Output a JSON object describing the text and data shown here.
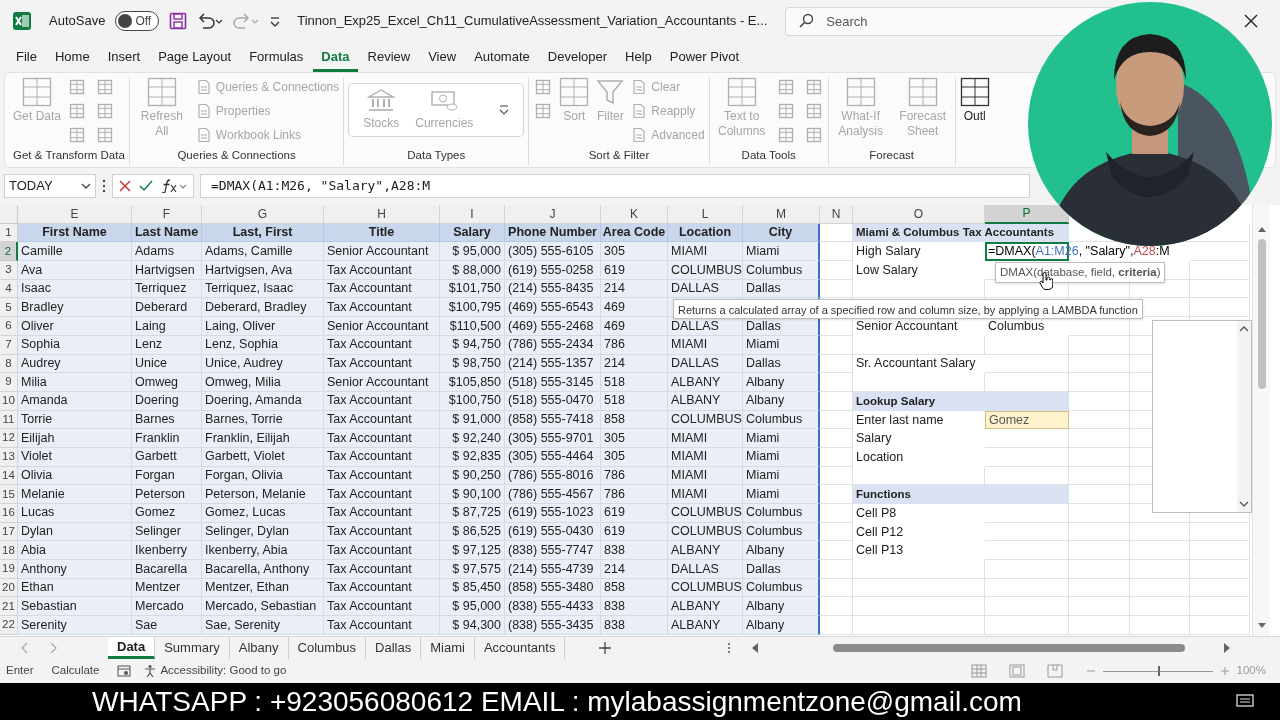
{
  "title_bar": {
    "autosave_label": "AutoSave",
    "autosave": {
      "on": false,
      "label": "Off"
    },
    "filename": "Tinnon_Exp25_Excel_Ch11_CumulativeAssessment_Variation_Accountants - E...",
    "search_placeholder": "Search"
  },
  "menu_tabs": [
    {
      "label": "File",
      "selected": false
    },
    {
      "label": "Home",
      "selected": false
    },
    {
      "label": "Insert",
      "selected": false
    },
    {
      "label": "Page Layout",
      "selected": false
    },
    {
      "label": "Formulas",
      "selected": false
    },
    {
      "label": "Data",
      "selected": true
    },
    {
      "label": "Review",
      "selected": false
    },
    {
      "label": "View",
      "selected": false
    },
    {
      "label": "Automate",
      "selected": false
    },
    {
      "label": "Developer",
      "selected": false
    },
    {
      "label": "Help",
      "selected": false
    },
    {
      "label": "Power Pivot",
      "selected": false
    }
  ],
  "ribbon_groups": [
    {
      "label": "Get & Transform Data",
      "items": [
        {
          "kind": "large",
          "label": "Get Data",
          "disabled": true
        },
        {
          "kind": "icon",
          "disabled": true
        },
        {
          "kind": "icon",
          "disabled": true
        },
        {
          "kind": "icon",
          "disabled": true
        },
        {
          "kind": "icon",
          "disabled": true
        },
        {
          "kind": "icon",
          "disabled": true
        },
        {
          "kind": "icon",
          "disabled": true
        }
      ]
    },
    {
      "label": "Queries & Connections",
      "items": [
        {
          "kind": "large",
          "label": "Refresh All",
          "disabled": true
        },
        {
          "kind": "small",
          "label": "Queries & Connections",
          "disabled": true
        },
        {
          "kind": "small",
          "label": "Properties",
          "disabled": true
        },
        {
          "kind": "small",
          "label": "Workbook Links",
          "disabled": true
        }
      ]
    },
    {
      "label": "Data Types",
      "items": [
        {
          "kind": "gallery",
          "label": "Stocks",
          "disabled": true
        },
        {
          "kind": "gallery",
          "label": "Currencies",
          "disabled": true
        }
      ]
    },
    {
      "label": "Sort & Filter",
      "items": [
        {
          "kind": "icon",
          "disabled": true
        },
        {
          "kind": "icon",
          "disabled": true
        },
        {
          "kind": "large",
          "label": "Sort",
          "disabled": true
        },
        {
          "kind": "large",
          "label": "Filter",
          "disabled": true
        },
        {
          "kind": "small",
          "label": "Clear",
          "disabled": true
        },
        {
          "kind": "small",
          "label": "Reapply",
          "disabled": true
        },
        {
          "kind": "small",
          "label": "Advanced",
          "disabled": true
        }
      ]
    },
    {
      "label": "Data Tools",
      "items": [
        {
          "kind": "large",
          "label": "Text to Columns",
          "disabled": true
        },
        {
          "kind": "icon",
          "disabled": true
        },
        {
          "kind": "icon",
          "disabled": true
        },
        {
          "kind": "icon",
          "disabled": true
        },
        {
          "kind": "icon",
          "disabled": true
        },
        {
          "kind": "icon",
          "disabled": true
        },
        {
          "kind": "icon",
          "disabled": true
        }
      ]
    },
    {
      "label": "Forecast",
      "items": [
        {
          "kind": "large",
          "label": "What-If Analysis",
          "disabled": true
        },
        {
          "kind": "large",
          "label": "Forecast Sheet",
          "disabled": true
        }
      ]
    },
    {
      "items": [
        {
          "kind": "large",
          "label": "Outl",
          "disabled": false
        }
      ]
    }
  ],
  "formula_bar": {
    "name_box": "TODAY",
    "formula": "=DMAX(A1:M26, \"Salary\",A28:M"
  },
  "columns": [
    {
      "letter": "E",
      "selected": false
    },
    {
      "letter": "F",
      "selected": false
    },
    {
      "letter": "G",
      "selected": false
    },
    {
      "letter": "H",
      "selected": false
    },
    {
      "letter": "I",
      "selected": false
    },
    {
      "letter": "J",
      "selected": false
    },
    {
      "letter": "K",
      "selected": false
    },
    {
      "letter": "L",
      "selected": false
    },
    {
      "letter": "M",
      "selected": false
    },
    {
      "letter": "N",
      "selected": false
    },
    {
      "letter": "O",
      "selected": false
    },
    {
      "letter": "P",
      "selected": true
    }
  ],
  "rows": [
    {
      "number": "1",
      "selected": false,
      "cells": [
        "First Name",
        "Last Name",
        "Last, First",
        "Title",
        "Salary",
        "Phone Number",
        "Area Code",
        "Location",
        "City"
      ],
      "side": {
        "kind": "heading",
        "label": "Miami & Columbus Tax Accountants"
      }
    },
    {
      "number": "2",
      "selected": true,
      "cells": [
        "Camille",
        "Adams",
        "Adams, Camille",
        "Senior Accountant",
        "$ 95,000",
        "(305) 555-6105",
        "305",
        "MIAMI",
        "Miami"
      ],
      "side": {
        "kind": "formula",
        "label": "High Salary",
        "parts": [
          {
            "text": "=DMAX(",
            "color": "#000000"
          },
          {
            "text": "A1:M26",
            "color": "#4472c4"
          },
          {
            "text": ", \"Salary\",",
            "color": "#000000"
          },
          {
            "text": "A28",
            "color": "#c0504d"
          },
          {
            "text": ":M",
            "color": "#000000"
          }
        ]
      }
    },
    {
      "number": "3",
      "selected": false,
      "cells": [
        "Ava",
        "Hartvigsen",
        "Hartvigsen, Ava",
        "Tax Accountant",
        "$ 88,000",
        "(619) 555-0258",
        "619",
        "COLUMBUS",
        "Columbus"
      ],
      "side": {
        "kind": "plain",
        "label": "Low Salary"
      }
    },
    {
      "number": "4",
      "selected": false,
      "cells": [
        "Isaac",
        "Terriquez",
        "Terriquez, Isaac",
        "Tax Accountant",
        "$101,750",
        "(214) 555-8435",
        "214",
        "DALLAS",
        "Dallas"
      ]
    },
    {
      "number": "5",
      "selected": false,
      "cells": [
        "Bradley",
        "Deberard",
        "Deberard, Bradley",
        "Tax Accountant",
        "$100,795",
        "(469) 555-6543",
        "469"
      ]
    },
    {
      "number": "6",
      "selected": false,
      "cells": [
        "Oliver",
        "Laing",
        "Laing, Oliver",
        "Senior Accountant",
        "$110,500",
        "(469) 555-2468",
        "469",
        "DALLAS",
        "Dallas"
      ],
      "side": {
        "kind": "plain",
        "label": "Senior Accountant",
        "value": "Columbus"
      }
    },
    {
      "number": "7",
      "selected": false,
      "cells": [
        "Sophia",
        "Lenz",
        "Lenz, Sophia",
        "Tax Accountant",
        "$ 94,750",
        "(786) 555-2434",
        "786",
        "MIAMI",
        "Miami"
      ]
    },
    {
      "number": "8",
      "selected": false,
      "cells": [
        "Audrey",
        "Unice",
        "Unice, Audrey",
        "Tax Accountant",
        "$ 98,750",
        "(214) 555-1357",
        "214",
        "DALLAS",
        "Dallas"
      ],
      "side": {
        "kind": "plain",
        "label": "Sr. Accountant Salary"
      }
    },
    {
      "number": "9",
      "selected": false,
      "cells": [
        "Milia",
        "Omweg",
        "Omweg, Milia",
        "Senior Accountant",
        "$105,850",
        "(518) 555-3145",
        "518",
        "ALBANY",
        "Albany"
      ]
    },
    {
      "number": "10",
      "selected": false,
      "cells": [
        "Amanda",
        "Doering",
        "Doering, Amanda",
        "Tax Accountant",
        "$100,750",
        "(518) 555-0470",
        "518",
        "ALBANY",
        "Albany"
      ],
      "side": {
        "kind": "heading",
        "label": "Lookup Salary"
      }
    },
    {
      "number": "11",
      "selected": false,
      "cells": [
        "Torrie",
        "Barnes",
        "Barnes, Torrie",
        "Tax Accountant",
        "$ 91,000",
        "(858) 555-7418",
        "858",
        "COLUMBUS",
        "Columbus"
      ],
      "side": {
        "kind": "input",
        "label": "Enter last name",
        "value": "Gomez"
      }
    },
    {
      "number": "12",
      "selected": false,
      "cells": [
        "Eilijah",
        "Franklin",
        "Franklin, Eilijah",
        "Tax Accountant",
        "$ 92,240",
        "(305) 555-9701",
        "305",
        "MIAMI",
        "Miami"
      ],
      "side": {
        "kind": "plain",
        "label": "Salary"
      }
    },
    {
      "number": "13",
      "selected": false,
      "cells": [
        "Violet",
        "Garbett",
        "Garbett, Violet",
        "Tax Accountant",
        "$ 92,835",
        "(305) 555-4464",
        "305",
        "MIAMI",
        "Miami"
      ],
      "side": {
        "kind": "plain",
        "label": "Location"
      }
    },
    {
      "number": "14",
      "selected": false,
      "cells": [
        "Olivia",
        "Forgan",
        "Forgan, Olivia",
        "Tax Accountant",
        "$ 90,250",
        "(786) 555-8016",
        "786",
        "MIAMI",
        "Miami"
      ]
    },
    {
      "number": "15",
      "selected": false,
      "cells": [
        "Melanie",
        "Peterson",
        "Peterson, Melanie",
        "Tax Accountant",
        "$ 90,100",
        "(786) 555-4567",
        "786",
        "MIAMI",
        "Miami"
      ],
      "side": {
        "kind": "heading",
        "label": "Functions"
      }
    },
    {
      "number": "16",
      "selected": false,
      "cells": [
        "Lucas",
        "Gomez",
        "Gomez, Lucas",
        "Tax Accountant",
        "$ 87,725",
        "(619) 555-1023",
        "619",
        "COLUMBUS",
        "Columbus"
      ],
      "side": {
        "kind": "plain",
        "label": "Cell P8"
      }
    },
    {
      "number": "17",
      "selected": false,
      "cells": [
        "Dylan",
        "Selinger",
        "Selinger, Dylan",
        "Tax Accountant",
        "$ 86,525",
        "(619) 555-0430",
        "619",
        "COLUMBUS",
        "Columbus"
      ],
      "side": {
        "kind": "plain",
        "label": "Cell P12"
      }
    },
    {
      "number": "18",
      "selected": false,
      "cells": [
        "Abia",
        "Ikenberry",
        "Ikenberry, Abia",
        "Tax Accountant",
        "$ 97,125",
        "(838) 555-7747",
        "838",
        "ALBANY",
        "Albany"
      ],
      "side": {
        "kind": "plain",
        "label": "Cell P13"
      }
    },
    {
      "number": "19",
      "selected": false,
      "cells": [
        "Anthony",
        "Bacarella",
        "Bacarella, Anthony",
        "Tax Accountant",
        "$ 97,575",
        "(214) 555-4739",
        "214",
        "DALLAS",
        "Dallas"
      ]
    },
    {
      "number": "20",
      "selected": false,
      "cells": [
        "Ethan",
        "Mentzer",
        "Mentzer, Ethan",
        "Tax Accountant",
        "$ 85,450",
        "(858) 555-3480",
        "858",
        "COLUMBUS",
        "Columbus"
      ]
    },
    {
      "number": "21",
      "selected": false,
      "cells": [
        "Sebastian",
        "Mercado",
        "Mercado, Sebastian",
        "Tax Accountant",
        "$ 95,000",
        "(838) 555-4433",
        "838",
        "ALBANY",
        "Albany"
      ]
    },
    {
      "number": "22",
      "selected": false,
      "cells": [
        "Serenity",
        "Sae",
        "Sae, Serenity",
        "Tax Accountant",
        "$ 94,300",
        "(838) 555-3435",
        "838",
        "ALBANY",
        "Albany"
      ]
    }
  ],
  "tooltips": {
    "syntax": "DMAX(database, field, **criteria**)",
    "description": "Returns a calculated array of a specified row and column size, by applying a LAMBDA function"
  },
  "sheet_tabs": [
    {
      "label": "Data",
      "selected": true
    },
    {
      "label": "Summary",
      "selected": false
    },
    {
      "label": "Albany",
      "selected": false
    },
    {
      "label": "Columbus",
      "selected": false
    },
    {
      "label": "Dallas",
      "selected": false
    },
    {
      "label": "Miami",
      "selected": false
    },
    {
      "label": "Accountants",
      "selected": false
    }
  ],
  "status_bar": {
    "mode": "Enter",
    "calculate": "Calculate",
    "accessibility": "Accessibility: Good to go",
    "zoom": {
      "label": "100%",
      "level": 0.5
    }
  },
  "banner": "WHATSAPP : +923056080612 EMAIL : mylabassignmentzone@gmail.com"
}
